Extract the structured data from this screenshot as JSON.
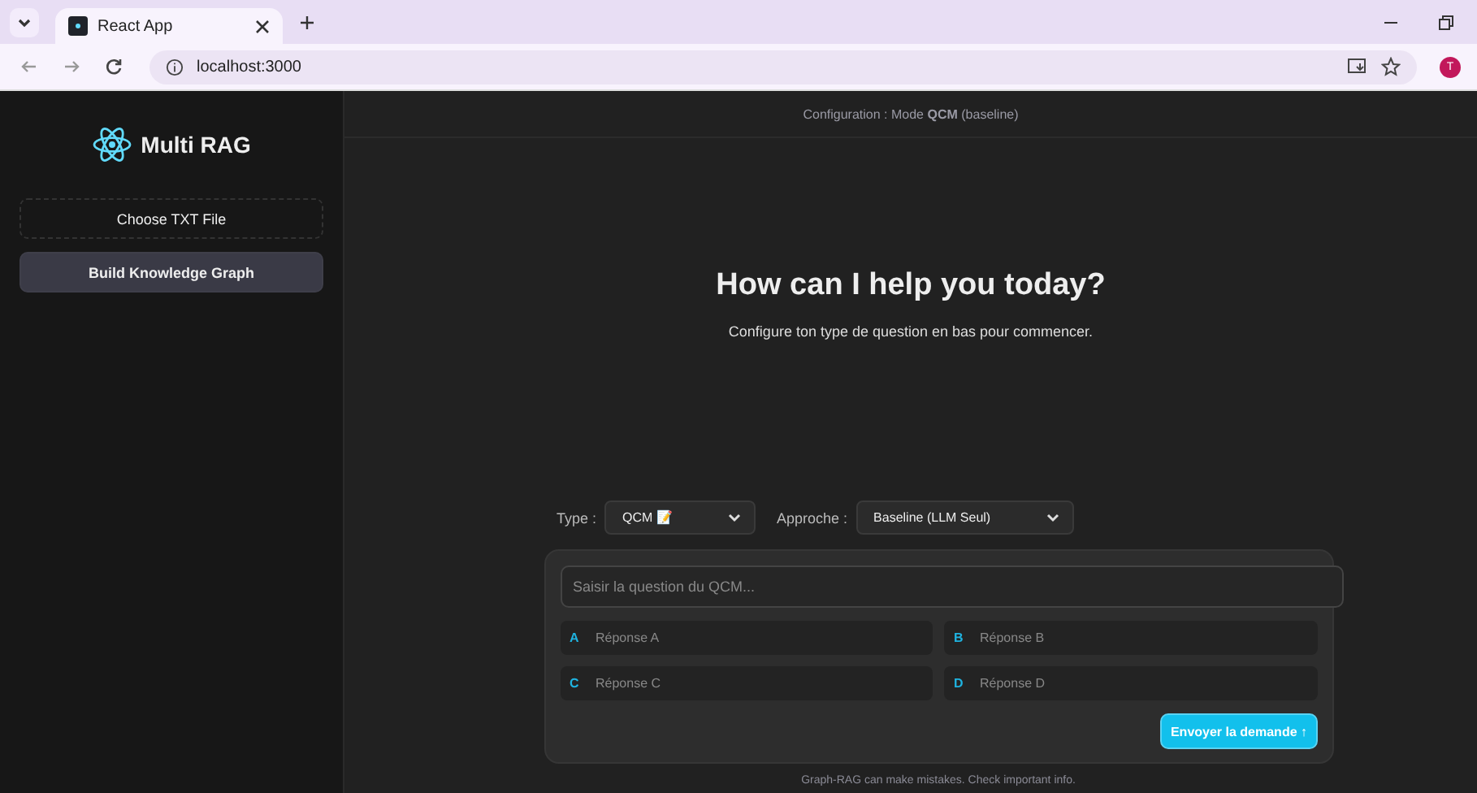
{
  "browser": {
    "tab_title": "React App",
    "address": "localhost:3000",
    "profile_initial": "T"
  },
  "sidebar": {
    "app_name": "Multi RAG",
    "buttons": [
      {
        "label": "Choose TXT File",
        "kind": "outline"
      },
      {
        "label": "Build Knowledge Graph",
        "kind": "filled"
      }
    ]
  },
  "header": {
    "text": "Configuration : Mode **QCM** (baseline)"
  },
  "hero": {
    "title": "How can I help you today?",
    "subtitle": "Configure ton type de question en bas pour commencer."
  },
  "controls": {
    "type_label": "Type :",
    "type_value": "QCM 📝",
    "approach_label": "Approche :",
    "approach_value": "Baseline (LLM Seul)"
  },
  "question": {
    "placeholder": "Saisir la question du QCM..."
  },
  "answers": [
    {
      "letter": "A",
      "placeholder": "Réponse A"
    },
    {
      "letter": "B",
      "placeholder": "Réponse B"
    },
    {
      "letter": "C",
      "placeholder": "Réponse C"
    },
    {
      "letter": "D",
      "placeholder": "Réponse D"
    }
  ],
  "send_button": "Envoyer la demande ↑",
  "footer": "Graph-RAG can make mistakes. Check important info."
}
